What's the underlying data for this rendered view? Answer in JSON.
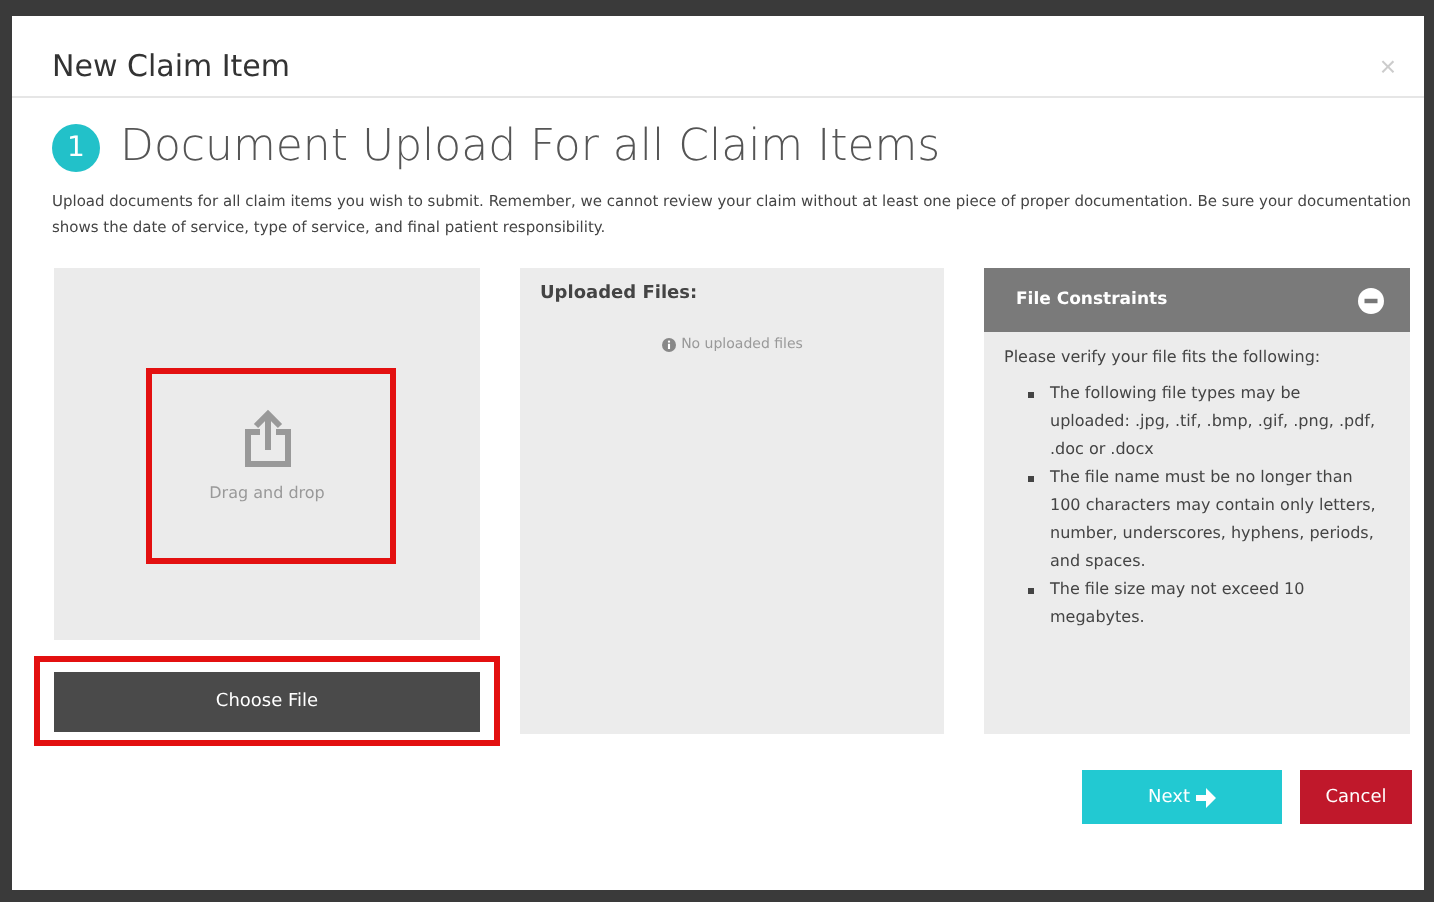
{
  "dialog": {
    "title": "New Claim Item",
    "close": "×"
  },
  "step": {
    "number": "1",
    "heading": "Document Upload For all Claim Items",
    "description": "Upload documents for all claim items you wish to submit. Remember, we cannot review your claim without at least one piece of proper documentation. Be sure your documentation shows the date of service, type of service, and final patient responsibility."
  },
  "dropzone": {
    "label": "Drag and drop",
    "button": "Choose File"
  },
  "uploaded": {
    "title": "Uploaded Files:",
    "empty": "No uploaded files"
  },
  "constraints": {
    "title": "File Constraints",
    "expanded": true,
    "intro": "Please verify your file fits the following:",
    "items": [
      "The following file types may be uploaded: .jpg, .tif, .bmp, .gif, .png, .pdf, .doc or .docx",
      "The file name must be no longer than 100 characters may contain only letters, number, underscores, hyphens, periods, and spaces.",
      "The file size may not exceed 10 megabytes."
    ]
  },
  "buttons": {
    "next": "Next",
    "cancel": "Cancel"
  }
}
